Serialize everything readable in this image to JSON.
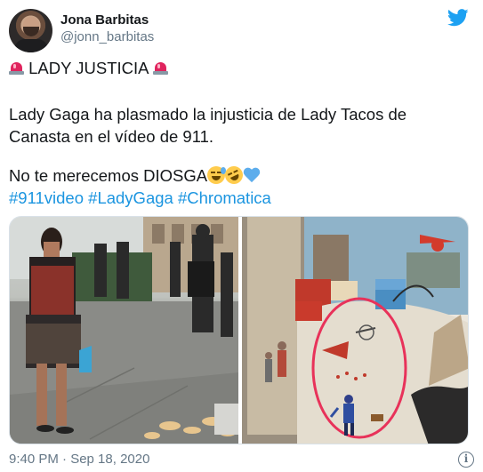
{
  "author": {
    "display_name": "Jona Barbitas",
    "handle": "@jonn_barbitas"
  },
  "tweet": {
    "line1_text": "LADY JUSTICIA",
    "line2_text": "Lady Gaga ha plasmado la injusticia de Lady Tacos de Canasta en el vídeo de 911.",
    "line3_text": "No te merecemos DIOSGA",
    "hashtags": [
      "#911video",
      "#LadyGaga",
      "#Chromatica"
    ],
    "timestamp": "9:40 PM · Sep 18, 2020"
  },
  "icons": {
    "brand": "twitter-bird-icon",
    "emojis": [
      "police-light-icon",
      "grinning-sweat-icon",
      "rofl-icon",
      "blue-heart-icon"
    ],
    "info": "info-icon"
  },
  "colors": {
    "link": "#1b95e0",
    "secondary_text": "#657786",
    "brand": "#1da1f2"
  }
}
